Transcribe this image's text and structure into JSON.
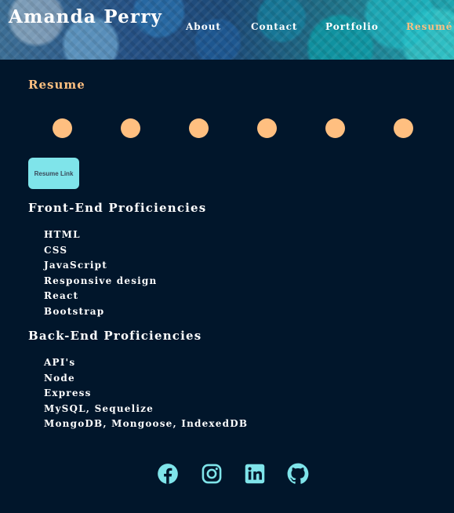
{
  "header": {
    "brand": "Amanda Perry",
    "nav": [
      {
        "label": "About"
      },
      {
        "label": "Contact"
      },
      {
        "label": "Portfolio"
      },
      {
        "label": "Resumé",
        "active": true
      }
    ]
  },
  "resume": {
    "title": "Resume",
    "link_label": "Resume Link"
  },
  "front_end": {
    "title": "Front-End Proficiencies",
    "items": [
      "HTML",
      "CSS",
      "JavaScript",
      "Responsive design",
      "React",
      "Bootstrap"
    ]
  },
  "back_end": {
    "title": "Back-End Proficiencies",
    "items": [
      "API's",
      "Node",
      "Express",
      "MySQL, Sequelize",
      "MongoDB, Mongoose, IndexedDB"
    ]
  },
  "social": [
    {
      "icon": "facebook-icon"
    },
    {
      "icon": "instagram-icon"
    },
    {
      "icon": "linkedin-icon"
    },
    {
      "icon": "github-icon"
    }
  ],
  "colors": {
    "background": "#01162b",
    "accent": "#ffbf80",
    "button": "#7fe4ea",
    "icon": "#7fe4ea"
  }
}
